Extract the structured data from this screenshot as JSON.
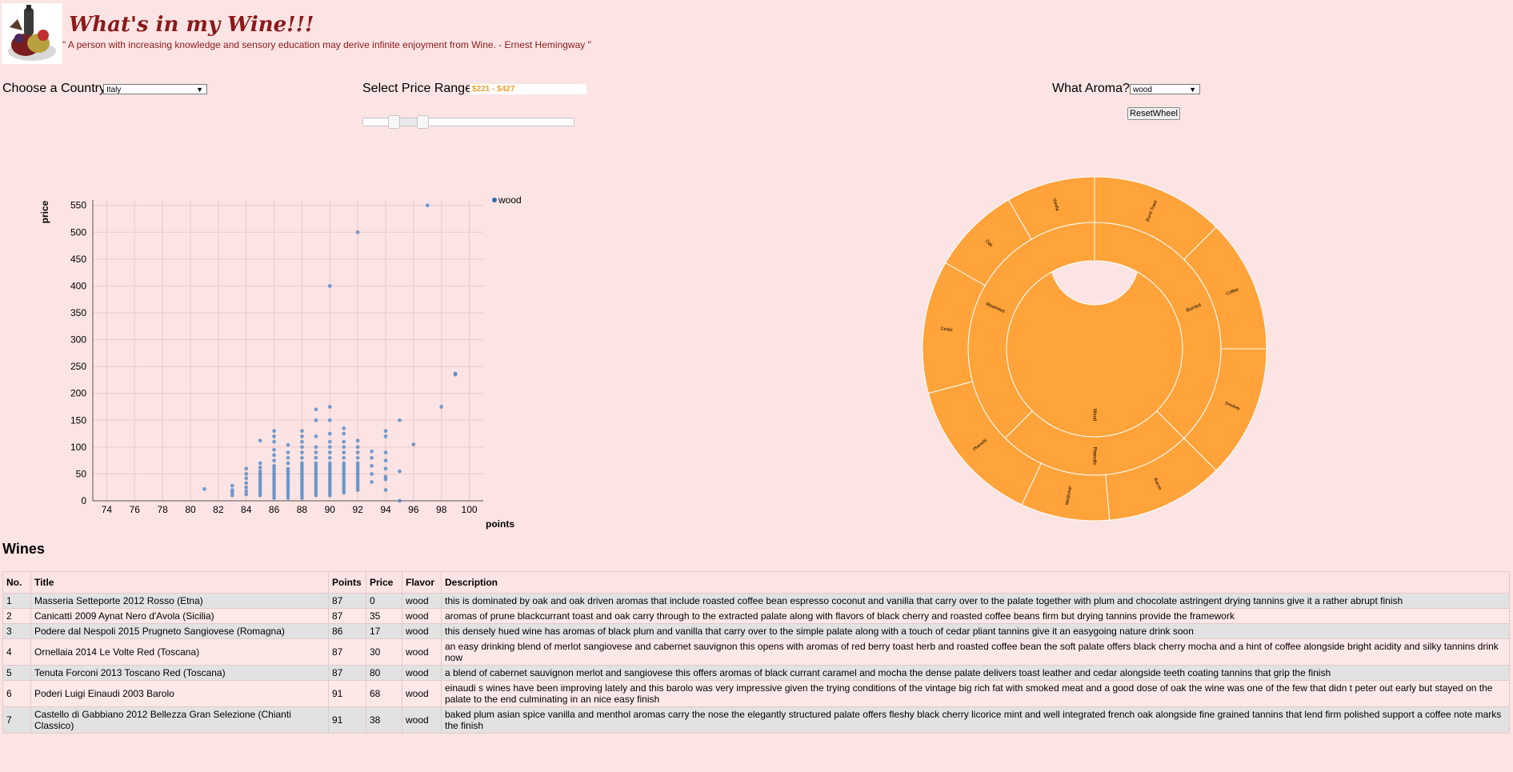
{
  "header": {
    "title": "What's in my Wine!!!",
    "quote": "\" A person with increasing knowledge and sensory education may derive infinite enjoyment from Wine. - Ernest Hemingway \""
  },
  "controls": {
    "country_label": "Choose a Country:",
    "country_value": "Italy",
    "price_label": "Select Price Range:",
    "price_value": "$221 - $427",
    "price_slider": {
      "min_selected": 221,
      "max_selected": 427
    },
    "aroma_label": "What Aroma?:",
    "aroma_value": "wood",
    "reset_label": "ResetWheel"
  },
  "colors": {
    "background": "#fce4e4",
    "title": "#8b1a1a",
    "points": "#4a86c5",
    "wheel": "#ffa33a",
    "price_text": "#f0a030"
  },
  "chart_data": {
    "type": "scatter",
    "xlabel": "points",
    "ylabel": "price",
    "xlim": [
      73,
      101
    ],
    "ylim": [
      0,
      560
    ],
    "xticks": [
      74,
      76,
      78,
      80,
      82,
      84,
      86,
      88,
      90,
      92,
      94,
      96,
      98,
      100
    ],
    "yticks": [
      0,
      50,
      100,
      150,
      200,
      250,
      300,
      350,
      400,
      450,
      500,
      550
    ],
    "grid": true,
    "legend_position": "top-right",
    "series": [
      {
        "name": "wood",
        "points": [
          [
            81,
            22
          ],
          [
            83,
            10
          ],
          [
            83,
            15
          ],
          [
            83,
            20
          ],
          [
            83,
            28
          ],
          [
            84,
            12
          ],
          [
            84,
            18
          ],
          [
            84,
            25
          ],
          [
            84,
            33
          ],
          [
            84,
            42
          ],
          [
            84,
            50
          ],
          [
            84,
            60
          ],
          [
            85,
            10
          ],
          [
            85,
            15
          ],
          [
            85,
            20
          ],
          [
            85,
            25
          ],
          [
            85,
            30
          ],
          [
            85,
            35
          ],
          [
            85,
            40
          ],
          [
            85,
            45
          ],
          [
            85,
            50
          ],
          [
            85,
            55
          ],
          [
            85,
            62
          ],
          [
            85,
            70
          ],
          [
            85,
            112
          ],
          [
            86,
            5
          ],
          [
            86,
            10
          ],
          [
            86,
            15
          ],
          [
            86,
            20
          ],
          [
            86,
            25
          ],
          [
            86,
            30
          ],
          [
            86,
            35
          ],
          [
            86,
            40
          ],
          [
            86,
            45
          ],
          [
            86,
            50
          ],
          [
            86,
            55
          ],
          [
            86,
            60
          ],
          [
            86,
            65
          ],
          [
            86,
            75
          ],
          [
            86,
            85
          ],
          [
            86,
            95
          ],
          [
            86,
            110
          ],
          [
            86,
            120
          ],
          [
            86,
            130
          ],
          [
            87,
            5
          ],
          [
            87,
            10
          ],
          [
            87,
            15
          ],
          [
            87,
            20
          ],
          [
            87,
            25
          ],
          [
            87,
            30
          ],
          [
            87,
            35
          ],
          [
            87,
            40
          ],
          [
            87,
            45
          ],
          [
            87,
            50
          ],
          [
            87,
            55
          ],
          [
            87,
            60
          ],
          [
            87,
            70
          ],
          [
            87,
            80
          ],
          [
            87,
            90
          ],
          [
            87,
            104
          ],
          [
            88,
            5
          ],
          [
            88,
            10
          ],
          [
            88,
            15
          ],
          [
            88,
            20
          ],
          [
            88,
            25
          ],
          [
            88,
            30
          ],
          [
            88,
            35
          ],
          [
            88,
            40
          ],
          [
            88,
            45
          ],
          [
            88,
            50
          ],
          [
            88,
            55
          ],
          [
            88,
            60
          ],
          [
            88,
            65
          ],
          [
            88,
            70
          ],
          [
            88,
            80
          ],
          [
            88,
            90
          ],
          [
            88,
            100
          ],
          [
            88,
            110
          ],
          [
            88,
            120
          ],
          [
            88,
            130
          ],
          [
            89,
            10
          ],
          [
            89,
            15
          ],
          [
            89,
            20
          ],
          [
            89,
            25
          ],
          [
            89,
            30
          ],
          [
            89,
            35
          ],
          [
            89,
            40
          ],
          [
            89,
            45
          ],
          [
            89,
            50
          ],
          [
            89,
            55
          ],
          [
            89,
            60
          ],
          [
            89,
            65
          ],
          [
            89,
            70
          ],
          [
            89,
            80
          ],
          [
            89,
            90
          ],
          [
            89,
            100
          ],
          [
            89,
            120
          ],
          [
            89,
            150
          ],
          [
            89,
            170
          ],
          [
            90,
            10
          ],
          [
            90,
            15
          ],
          [
            90,
            20
          ],
          [
            90,
            25
          ],
          [
            90,
            30
          ],
          [
            90,
            35
          ],
          [
            90,
            40
          ],
          [
            90,
            45
          ],
          [
            90,
            50
          ],
          [
            90,
            55
          ],
          [
            90,
            60
          ],
          [
            90,
            65
          ],
          [
            90,
            70
          ],
          [
            90,
            80
          ],
          [
            90,
            90
          ],
          [
            90,
            100
          ],
          [
            90,
            110
          ],
          [
            90,
            125
          ],
          [
            90,
            150
          ],
          [
            90,
            175
          ],
          [
            90,
            400
          ],
          [
            91,
            15
          ],
          [
            91,
            20
          ],
          [
            91,
            25
          ],
          [
            91,
            30
          ],
          [
            91,
            35
          ],
          [
            91,
            40
          ],
          [
            91,
            45
          ],
          [
            91,
            50
          ],
          [
            91,
            55
          ],
          [
            91,
            60
          ],
          [
            91,
            65
          ],
          [
            91,
            70
          ],
          [
            91,
            80
          ],
          [
            91,
            90
          ],
          [
            91,
            100
          ],
          [
            91,
            110
          ],
          [
            91,
            125
          ],
          [
            91,
            135
          ],
          [
            92,
            20
          ],
          [
            92,
            25
          ],
          [
            92,
            30
          ],
          [
            92,
            35
          ],
          [
            92,
            40
          ],
          [
            92,
            45
          ],
          [
            92,
            50
          ],
          [
            92,
            55
          ],
          [
            92,
            60
          ],
          [
            92,
            65
          ],
          [
            92,
            70
          ],
          [
            92,
            80
          ],
          [
            92,
            90
          ],
          [
            92,
            100
          ],
          [
            92,
            112
          ],
          [
            92,
            500
          ],
          [
            93,
            35
          ],
          [
            93,
            50
          ],
          [
            93,
            65
          ],
          [
            93,
            80
          ],
          [
            93,
            92
          ],
          [
            94,
            20
          ],
          [
            94,
            40
          ],
          [
            94,
            45
          ],
          [
            94,
            60
          ],
          [
            94,
            75
          ],
          [
            94,
            90
          ],
          [
            94,
            120
          ],
          [
            94,
            130
          ],
          [
            95,
            0
          ],
          [
            95,
            55
          ],
          [
            95,
            150
          ],
          [
            96,
            105
          ],
          [
            97,
            550
          ],
          [
            98,
            175
          ],
          [
            99,
            235
          ],
          [
            99,
            237
          ]
        ]
      }
    ]
  },
  "aroma_wheel": {
    "inner": [
      {
        "label": "Wood",
        "start": 0,
        "end": 360
      }
    ],
    "middle": [
      {
        "label": "Burned",
        "start": 0,
        "end": 135
      },
      {
        "label": "Phenolic",
        "start": 135,
        "end": 225
      },
      {
        "label": "Resinous",
        "start": 225,
        "end": 360
      }
    ],
    "outer": [
      {
        "label": "Burnt Toast",
        "start": 0,
        "end": 45
      },
      {
        "label": "Coffee",
        "start": 45,
        "end": 90
      },
      {
        "label": "Smokey",
        "start": 90,
        "end": 135
      },
      {
        "label": "Bacon",
        "start": 135,
        "end": 175
      },
      {
        "label": "Medicinal",
        "start": 175,
        "end": 205
      },
      {
        "label": "Phenolic",
        "start": 205,
        "end": 255
      },
      {
        "label": "Cedar",
        "start": 255,
        "end": 300
      },
      {
        "label": "Oak",
        "start": 300,
        "end": 330
      },
      {
        "label": "Vanilla",
        "start": 330,
        "end": 360
      }
    ]
  },
  "table": {
    "heading": "Wines",
    "columns": [
      "No.",
      "Title",
      "Points",
      "Price",
      "Flavor",
      "Description"
    ],
    "rows": [
      [
        "1",
        "Masseria Setteporte 2012 Rosso (Etna)",
        "87",
        "0",
        "wood",
        "this is dominated by oak and oak driven aromas that include roasted coffee bean espresso coconut and vanilla that carry over to the palate together with plum and chocolate astringent drying tannins give it a rather abrupt finish"
      ],
      [
        "2",
        "Canicattì 2009 Aynat Nero d'Avola (Sicilia)",
        "87",
        "35",
        "wood",
        "aromas of prune blackcurrant toast and oak carry through to the extracted palate along with flavors of black cherry and roasted coffee beans firm but drying tannins provide the framework"
      ],
      [
        "3",
        "Podere dal Nespoli 2015 Prugneto Sangiovese (Romagna)",
        "86",
        "17",
        "wood",
        "this densely hued wine has aromas of black plum and vanilla that carry over to the simple palate along with a touch of cedar pliant tannins give it an easygoing nature drink soon"
      ],
      [
        "4",
        "Ornellaia 2014 Le Volte Red (Toscana)",
        "87",
        "30",
        "wood",
        "an easy drinking blend of merlot sangiovese and cabernet sauvignon this opens with aromas of red berry toast herb and roasted coffee bean the soft palate offers black cherry mocha and a hint of coffee alongside bright acidity and silky tannins drink now"
      ],
      [
        "5",
        "Tenuta Forconi 2013 Toscano Red (Toscana)",
        "87",
        "80",
        "wood",
        "a blend of cabernet sauvignon merlot and sangiovese this offers aromas of black currant caramel and mocha the dense palate delivers toast leather and cedar alongside teeth coating tannins that grip the finish"
      ],
      [
        "6",
        "Poderi Luigi Einaudi 2003 Barolo",
        "91",
        "68",
        "wood",
        "einaudi s wines have been improving lately and this barolo was very impressive given the trying conditions of the vintage big rich fat with smoked meat and a good dose of oak the wine was one of the few that didn t peter out early but stayed on the palate to the end culminating in an nice easy finish"
      ],
      [
        "7",
        "Castello di Gabbiano 2012 Bellezza Gran Selezione (Chianti Classico)",
        "91",
        "38",
        "wood",
        "baked plum asian spice vanilla and menthol aromas carry the nose the elegantly structured palate offers fleshy black cherry licorice mint and well integrated french oak alongside fine grained tannins that lend firm polished support a coffee note marks the finish"
      ]
    ]
  }
}
